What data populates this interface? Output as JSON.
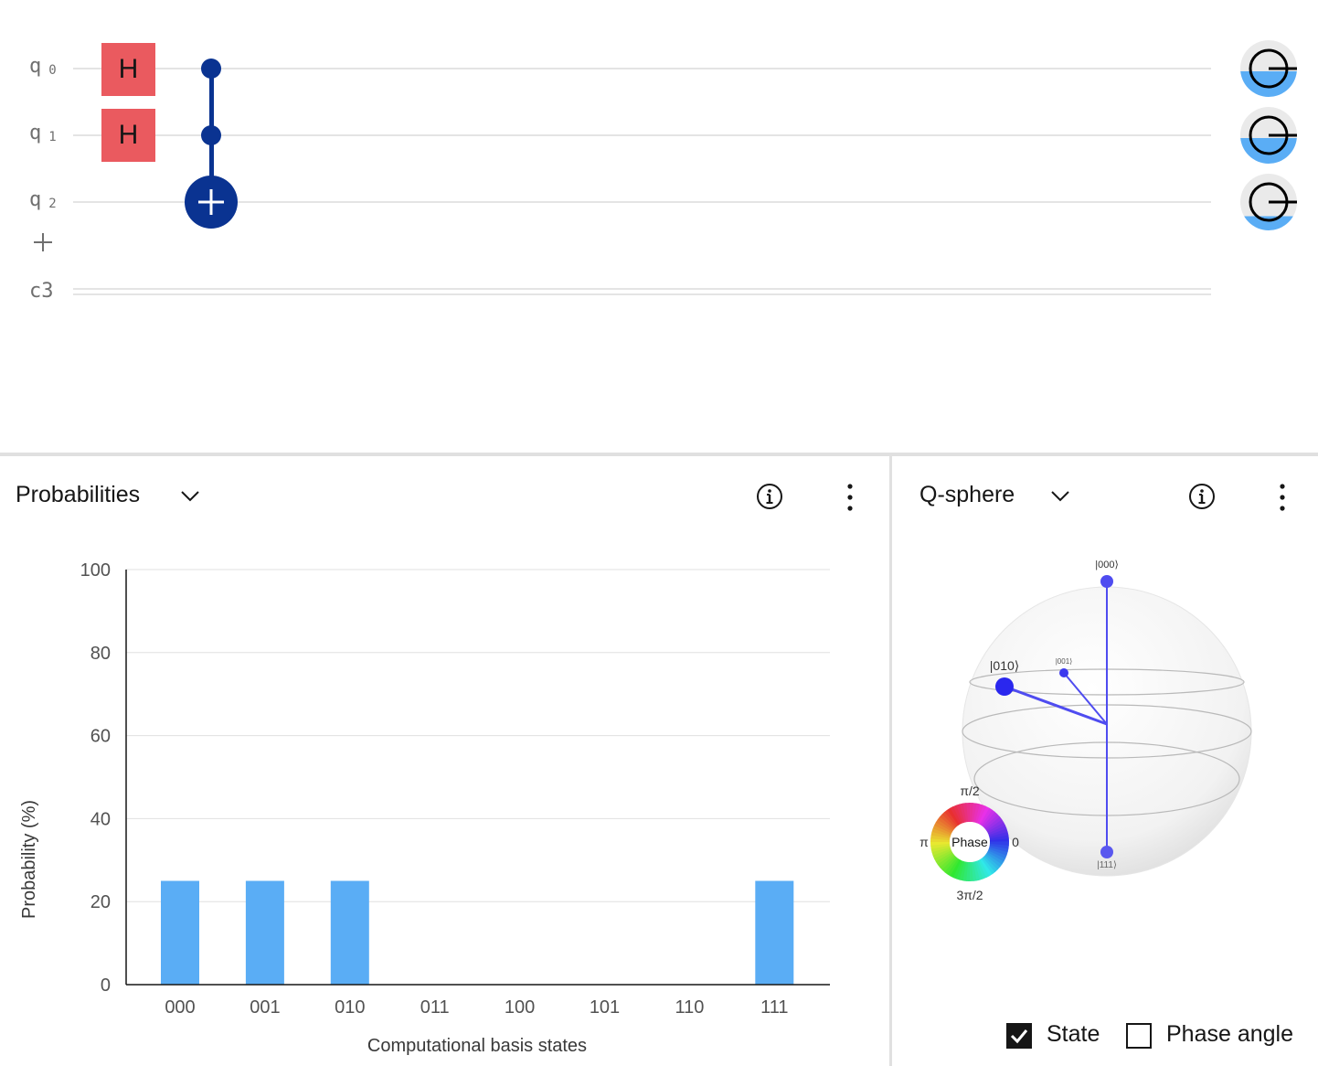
{
  "circuit": {
    "qubits": [
      {
        "name": "q",
        "index": "0"
      },
      {
        "name": "q",
        "index": "1"
      },
      {
        "name": "q",
        "index": "2"
      }
    ],
    "classical_register": "c3",
    "gates": {
      "h_label": "H"
    },
    "measurement_probabilities_one": [
      0.45,
      0.45,
      0.25
    ]
  },
  "probabilities_panel": {
    "title": "Probabilities",
    "icons": [
      "chevron-down-icon",
      "info-icon",
      "overflow-menu-icon"
    ]
  },
  "qsphere_panel": {
    "title": "Q-sphere",
    "icons": [
      "chevron-down-icon",
      "info-icon",
      "overflow-menu-icon"
    ],
    "state_labels": {
      "s000": "|000⟩",
      "s001": "|001⟩",
      "s010": "|010⟩",
      "s111": "|111⟩"
    },
    "phase_wheel": {
      "center": "Phase",
      "top": "π/2",
      "left": "π",
      "right": "0",
      "bottom": "3π/2"
    },
    "options": {
      "state": {
        "label": "State",
        "checked": true
      },
      "phase_angle": {
        "label": "Phase angle",
        "checked": false
      }
    }
  },
  "colors": {
    "bar": "#5aadf5",
    "gate_h": "#ea5a5f",
    "cnot": "#0a3391",
    "state_vector": "#4f4cf0"
  },
  "chart_data": {
    "type": "bar",
    "categories": [
      "000",
      "001",
      "010",
      "011",
      "100",
      "101",
      "110",
      "111"
    ],
    "values": [
      25,
      25,
      25,
      0,
      0,
      0,
      0,
      25
    ],
    "xlabel": "Computational basis states",
    "ylabel": "Probability (%)",
    "ylim": [
      0,
      100
    ],
    "yticks": [
      "0",
      "20",
      "40",
      "60",
      "80",
      "100"
    ],
    "grid": true
  }
}
